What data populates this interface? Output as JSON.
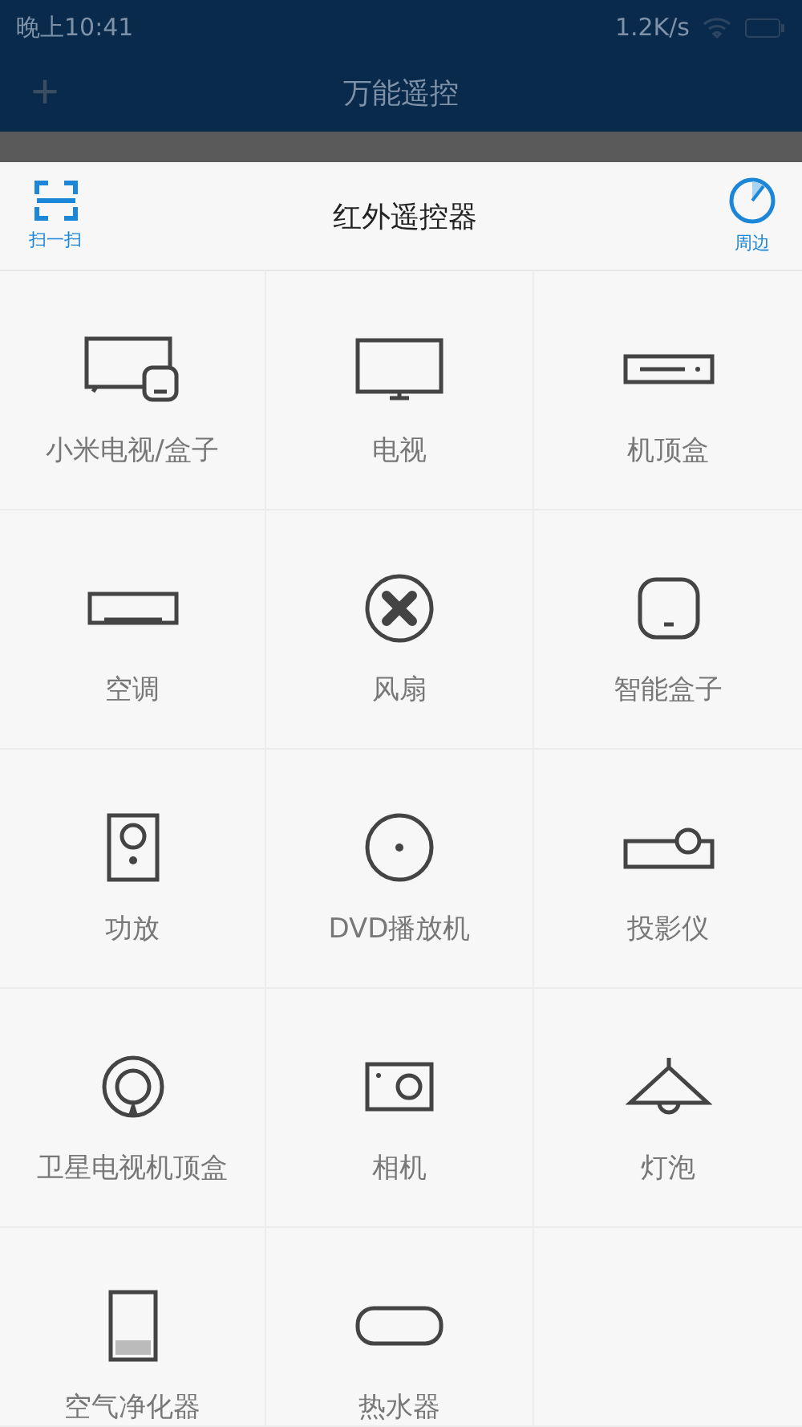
{
  "status_bar": {
    "time": "晚上10:41",
    "speed": "1.2K/s"
  },
  "app_bar": {
    "add": "+",
    "title": "万能遥控"
  },
  "sheet": {
    "scan_label": "扫一扫",
    "title": "红外遥控器",
    "nearby_label": "周边"
  },
  "devices": [
    {
      "label": "小米电视/盒子"
    },
    {
      "label": "电视"
    },
    {
      "label": "机顶盒"
    },
    {
      "label": "空调"
    },
    {
      "label": "风扇"
    },
    {
      "label": "智能盒子"
    },
    {
      "label": "功放"
    },
    {
      "label": "DVD播放机"
    },
    {
      "label": "投影仪"
    },
    {
      "label": "卫星电视机顶盒"
    },
    {
      "label": "相机"
    },
    {
      "label": "灯泡"
    },
    {
      "label": "空气净化器"
    },
    {
      "label": "热水器"
    }
  ]
}
